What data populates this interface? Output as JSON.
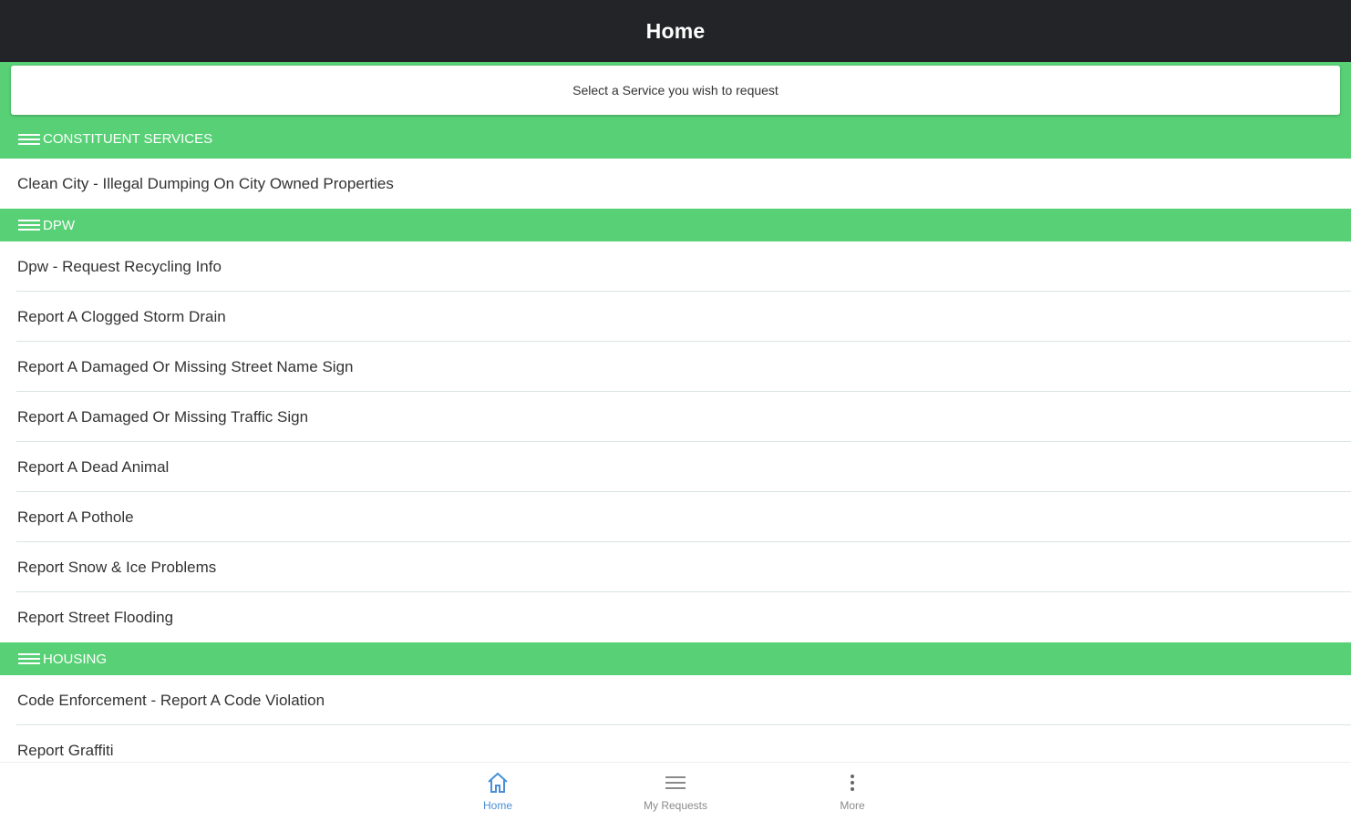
{
  "header": {
    "title": "Home"
  },
  "prompt": {
    "text": "Select a Service you wish to request"
  },
  "sections": [
    {
      "title": "CONSTITUENT SERVICES",
      "items": [
        "Clean City - Illegal Dumping On City Owned Properties"
      ]
    },
    {
      "title": "DPW",
      "items": [
        "Dpw - Request Recycling Info",
        "Report A Clogged Storm Drain",
        "Report A Damaged Or Missing Street Name Sign",
        "Report A Damaged Or Missing Traffic Sign",
        "Report A Dead Animal",
        "Report A Pothole",
        "Report Snow & Ice Problems",
        "Report Street Flooding"
      ]
    },
    {
      "title": "HOUSING",
      "items": [
        "Code Enforcement - Report A Code Violation",
        "Report Graffiti"
      ]
    }
  ],
  "bottom_nav": {
    "home": {
      "label": "Home",
      "icon": "home-icon",
      "active": true
    },
    "requests": {
      "label": "My Requests",
      "icon": "list-icon"
    },
    "more": {
      "label": "More",
      "icon": "more-vertical-icon"
    }
  },
  "colors": {
    "topbar": "#232427",
    "section_green": "#58d176",
    "active_nav": "#4a8fd6"
  }
}
